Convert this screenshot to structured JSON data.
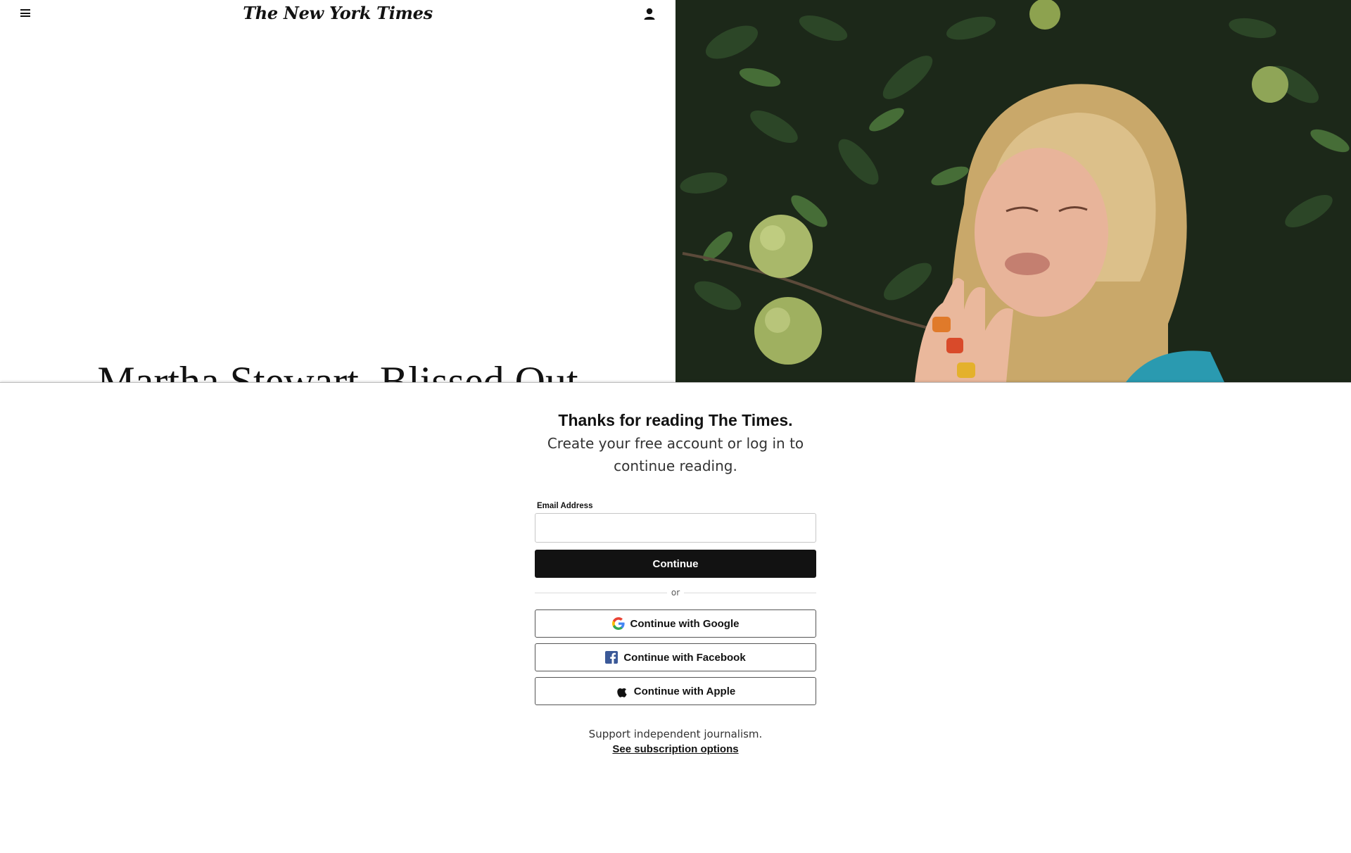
{
  "masthead": {
    "logo_text": "The New York Times",
    "menu_icon": "hamburger-menu-icon",
    "account_icon": "account-person-icon"
  },
  "article": {
    "headline": "Martha Stewart, Blissed Out"
  },
  "gate": {
    "title": "Thanks for reading The Times.",
    "subtitle": "Create your free account or log in to continue reading.",
    "email_label": "Email Address",
    "email_value": "",
    "continue_label": "Continue",
    "or_text": "or",
    "google_label": "Continue with Google",
    "facebook_label": "Continue with Facebook",
    "apple_label": "Continue with Apple",
    "support_text": "Support independent journalism.",
    "subscription_link": "See subscription options",
    "icons": {
      "google": "google-g-icon",
      "facebook": "facebook-f-icon",
      "apple": "apple-logo-icon"
    }
  },
  "colors": {
    "primary_button": "#121212",
    "facebook_blue": "#3b5998",
    "text": "#121212"
  }
}
